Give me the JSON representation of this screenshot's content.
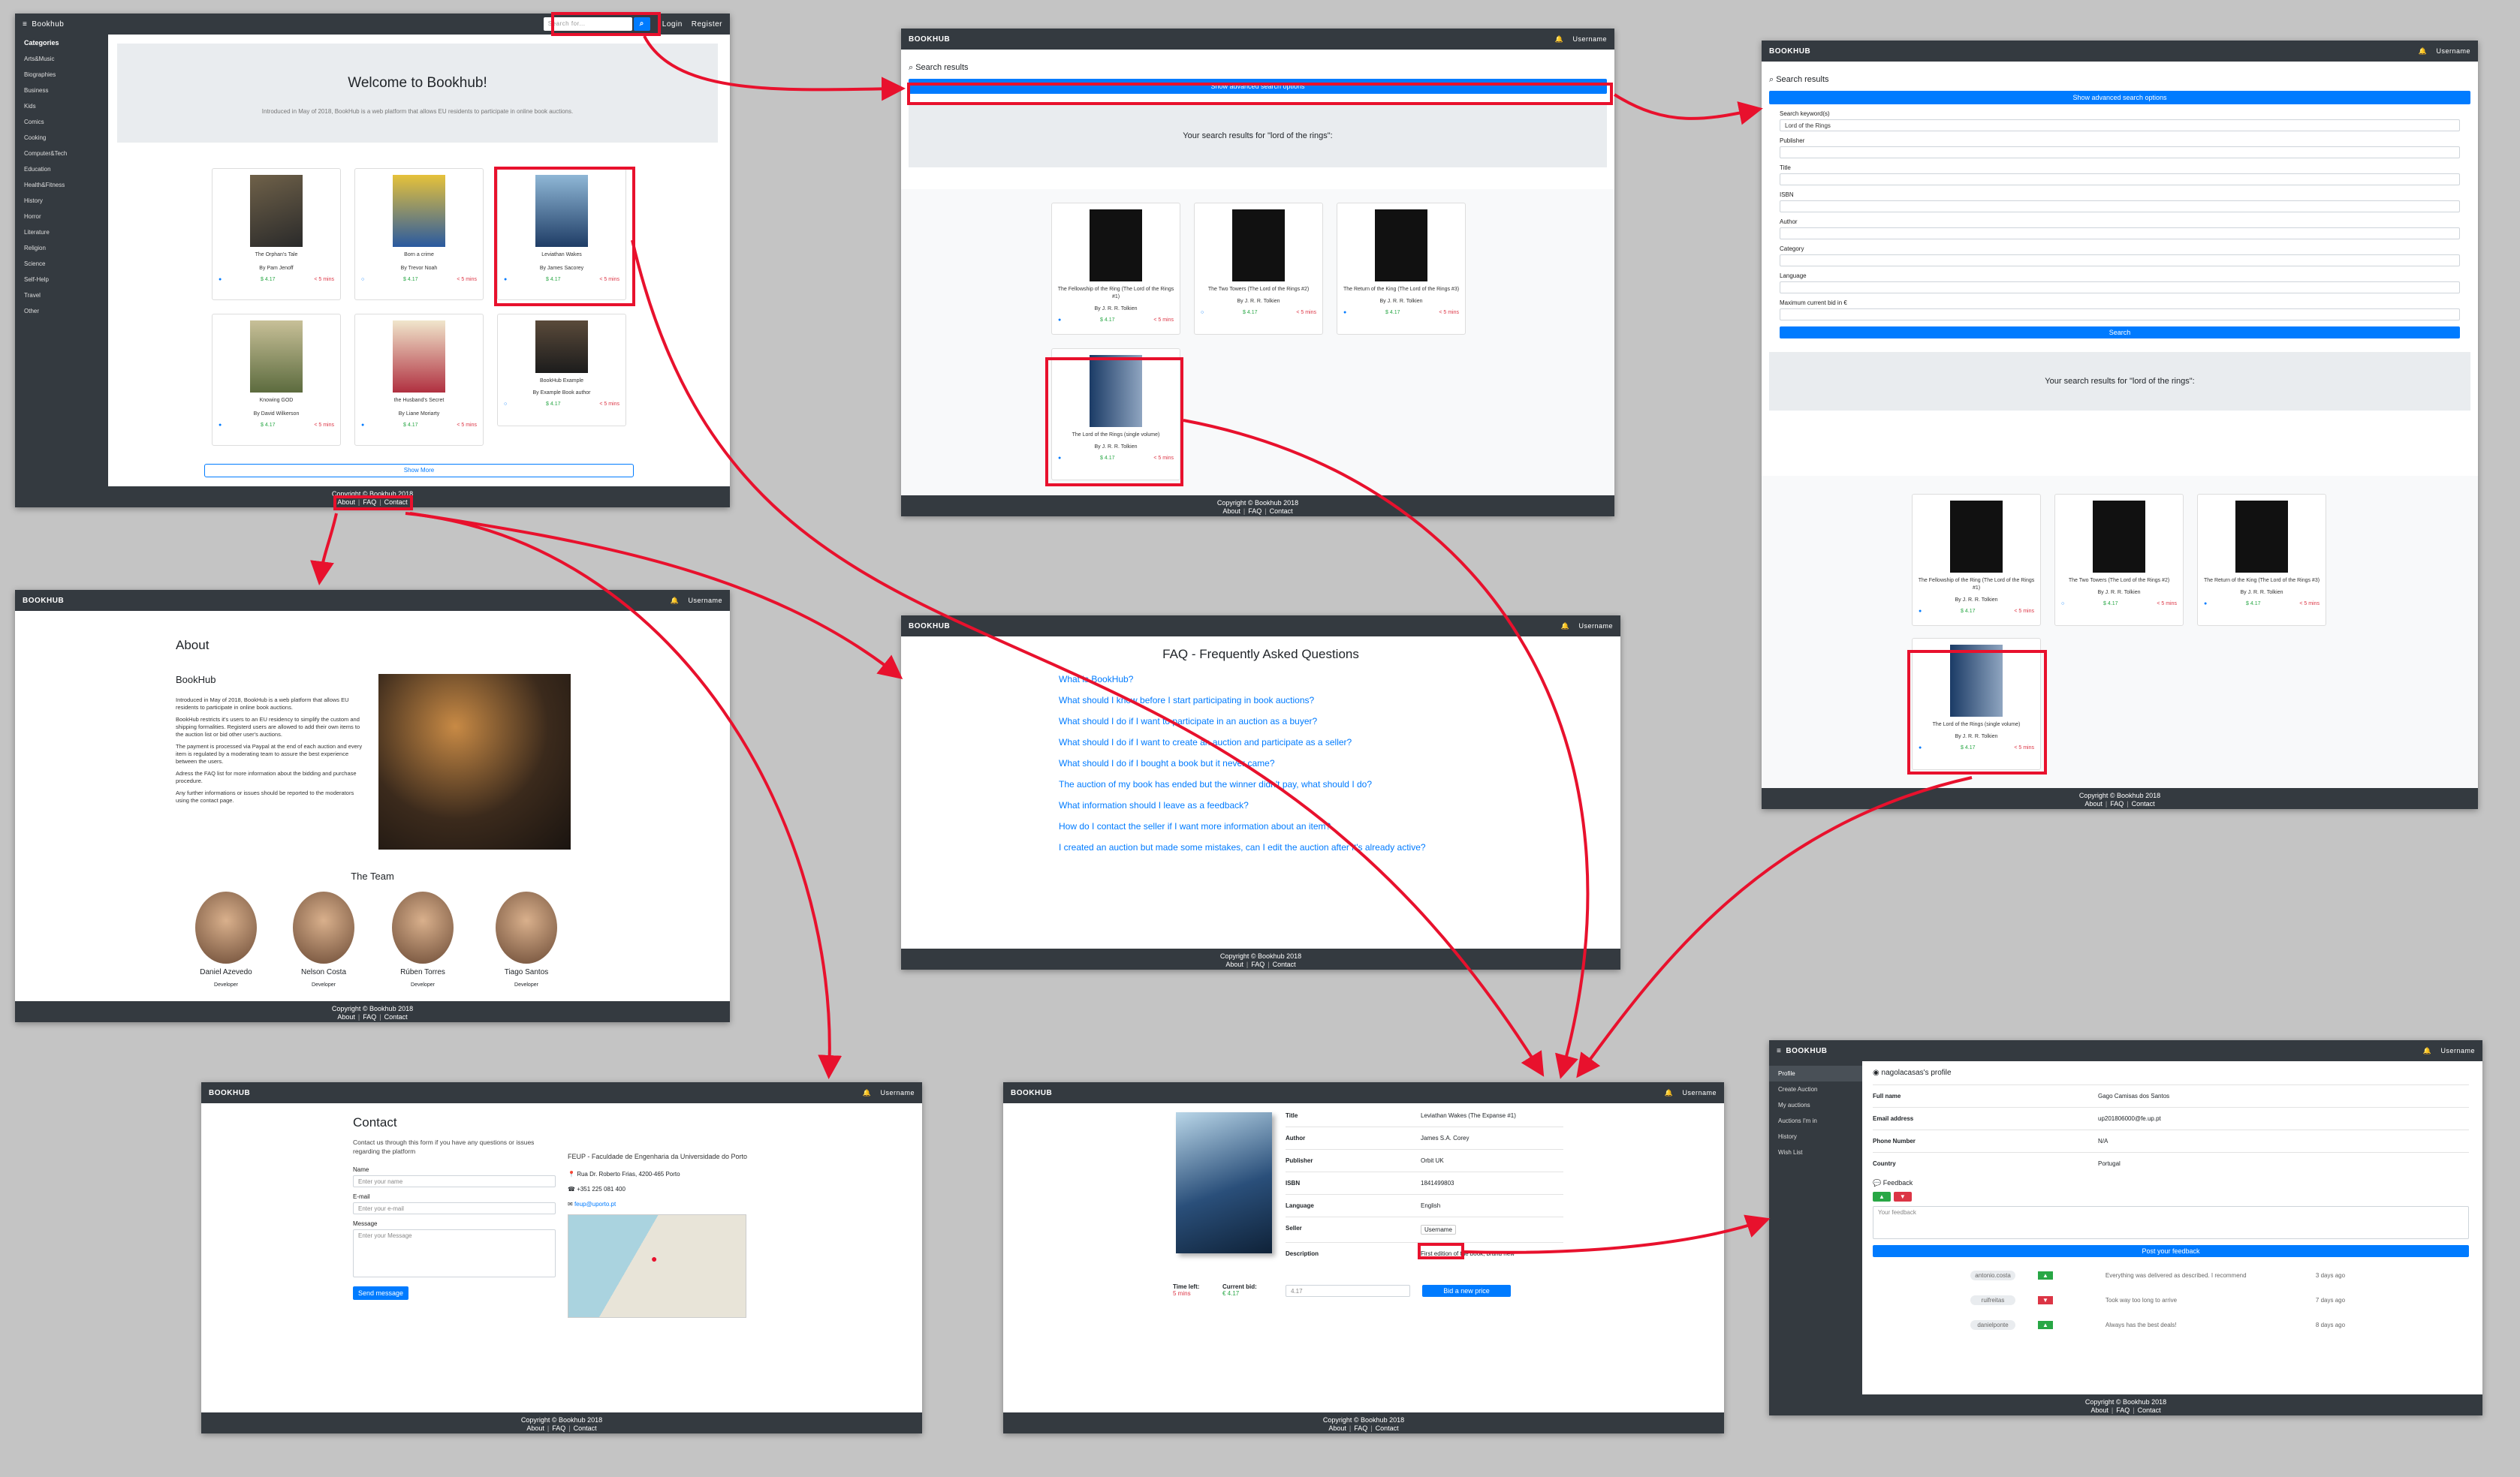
{
  "brand": "BOOKHUB",
  "nav_right": {
    "bell": "🔔",
    "user": "Username"
  },
  "footer": {
    "copyright": "Copyright © Bookhub 2018",
    "about": "About",
    "faq": "FAQ",
    "contact": "Contact"
  },
  "home": {
    "brand": "Bookhub",
    "search_placeholder": "Search for...",
    "login": "Login",
    "register": "Register",
    "categories_title": "Categories",
    "categories": [
      "Arts&Music",
      "Biographies",
      "Business",
      "Kids",
      "Comics",
      "Cooking",
      "Computer&Tech",
      "Education",
      "Health&Fitness",
      "History",
      "Horror",
      "Literature",
      "Religion",
      "Science",
      "Self-Help",
      "Travel",
      "Other"
    ],
    "welcome": "Welcome to Bookhub!",
    "intro": "Introduced in May of 2018, BookHub is a web platform that allows EU residents to participate in online book auctions.",
    "books": [
      {
        "title": "The Orphan's Tale",
        "author": "By Pam Jenoff",
        "price": "$ 4.17",
        "time": "< 5 mins"
      },
      {
        "title": "Born a crime",
        "author": "By Trevor Noah",
        "price": "$ 4.17",
        "time": "< 5 mins"
      },
      {
        "title": "Leviathan Wakes",
        "author": "By James Sacorey",
        "price": "$ 4.17",
        "time": "< 5 mins"
      },
      {
        "title": "Knowing GOD",
        "author": "By David Wilkerson",
        "price": "$ 4.17",
        "time": "< 5 mins"
      },
      {
        "title": "the Husband's Secret",
        "author": "By Liane Moriarty",
        "price": "$ 4.17",
        "time": "< 5 mins"
      },
      {
        "title": "BookHub Example",
        "author": "By Example Book author",
        "price": "$ 4.17",
        "time": "< 5 mins"
      }
    ],
    "show_more": "Show More"
  },
  "search": {
    "title": "Search results",
    "advanced_button": "Show advanced search options",
    "results_text": "Your search results for \"lord of the rings\":",
    "books": [
      {
        "title": "The Fellowship of the Ring (The Lord of the Rings #1)",
        "author": "By J. R. R. Tolkien",
        "price": "$ 4.17",
        "time": "< 5 mins"
      },
      {
        "title": "The Two Towers (The Lord of the Rings #2)",
        "author": "By J. R. R. Tolkien",
        "price": "$ 4.17",
        "time": "< 5 mins"
      },
      {
        "title": "The Return of the King (The Lord of the Rings #3)",
        "author": "By J. R. R. Tolkien",
        "price": "$ 4.17",
        "time": "< 5 mins"
      },
      {
        "title": "The Lord of the Rings (single volume)",
        "author": "By J. R. R. Tolkien",
        "price": "$ 4.17",
        "time": "< 5 mins"
      }
    ]
  },
  "advsearch": {
    "labels": [
      "Search keyword(s)",
      "Publisher",
      "Title",
      "ISBN",
      "Author",
      "Category",
      "Language",
      "Maximum current bid in €"
    ],
    "keyword_value": "Lord of the Rings",
    "search_button": "Search"
  },
  "about": {
    "title": "About",
    "subtitle": "BookHub",
    "paragraphs": [
      "Introduced in May of 2018, BookHub is a web platform that allows EU residents to participate in online book auctions.",
      "BookHub restricts it's users to an EU residency to simplify the custom and shipping formalities. Registerd users are allowed to add their own items to the auction list or bid other user's auctions.",
      "The payment is processed via Paypal at the end of each auction and every item is regulated by a moderating team to assure the best experience between the users.",
      "Adress the FAQ list for more information about the bidding and purchase procedure.",
      "Any further informations or issues should be reported to the moderators using the contact page."
    ],
    "team_title": "The Team",
    "team": [
      {
        "name": "Daniel Azevedo",
        "role": "Developer"
      },
      {
        "name": "Nelson Costa",
        "role": "Developer"
      },
      {
        "name": "Rúben Torres",
        "role": "Developer"
      },
      {
        "name": "Tiago Santos",
        "role": "Developer"
      }
    ]
  },
  "faq": {
    "title": "FAQ - Frequently Asked Questions",
    "questions": [
      "What is BookHub?",
      "What should I know before I start participating in book auctions?",
      "What should I do if I want to participate in an auction as a buyer?",
      "What should I do if I want to create an auction and participate as a seller?",
      "What should I do if I bought a book but it never came?",
      "The auction of my book has ended but the winner didn't pay, what should I do?",
      "What information should I leave as a feedback?",
      "How do I contact the seller if I want more information about an item?",
      "I created an auction but made some mistakes, can I edit the auction after it's already active?"
    ]
  },
  "contact": {
    "title": "Contact",
    "text": "Contact us through this form if you have any questions or issues regarding the platform",
    "name_label": "Name",
    "name_ph": "Enter your name",
    "email_label": "E-mail",
    "email_ph": "Enter your e-mail",
    "msg_label": "Message",
    "msg_ph": "Enter your Message",
    "send": "Send message",
    "org": "FEUP - Faculdade de Engenharia da Universidade do Porto",
    "address": "Rua Dr. Roberto Frias, 4200-465 Porto",
    "phone": "+351 225 081 400",
    "email": "feup@uporto.pt"
  },
  "auction": {
    "fields": [
      {
        "k": "Title",
        "v": "Leviathan Wakes (The Expanse #1)"
      },
      {
        "k": "Author",
        "v": "James S.A. Corey"
      },
      {
        "k": "Publisher",
        "v": "Orbit UK"
      },
      {
        "k": "ISBN",
        "v": "1841499803"
      },
      {
        "k": "Language",
        "v": "English"
      },
      {
        "k": "Seller",
        "v": "Username"
      },
      {
        "k": "Description",
        "v": "First edition of the book, brand new"
      }
    ],
    "time_left_label": "Time left:",
    "time_left": "5 mins",
    "current_bid_label": "Current bid:",
    "current_bid": "€ 4.17",
    "bid_input": "4.17",
    "bid_button": "Bid a new price"
  },
  "profile": {
    "title": "nagolacasas's profile",
    "menu": [
      "Profile",
      "Create Auction",
      "My auctions",
      "Auctions I'm in",
      "History",
      "Wish List"
    ],
    "rows": [
      {
        "k": "Full name",
        "v": "Gago Camisas dos Santos"
      },
      {
        "k": "Email address",
        "v": "up201806000@fe.up.pt"
      },
      {
        "k": "Phone Number",
        "v": "N/A"
      },
      {
        "k": "Country",
        "v": "Portugal"
      }
    ],
    "feedback_title": "Feedback",
    "feedback_ph": "Your feedback",
    "post_button": "Post your feedback",
    "feedback": [
      {
        "user": "antonio.costa",
        "text": "Everything was delivered as described. I recommend",
        "when": "3 days ago"
      },
      {
        "user": "ruifreitas",
        "text": "Took way too long to arrive",
        "when": "7 days ago"
      },
      {
        "user": "danielponte",
        "text": "Always has the best deals!",
        "when": "8 days ago"
      }
    ]
  }
}
